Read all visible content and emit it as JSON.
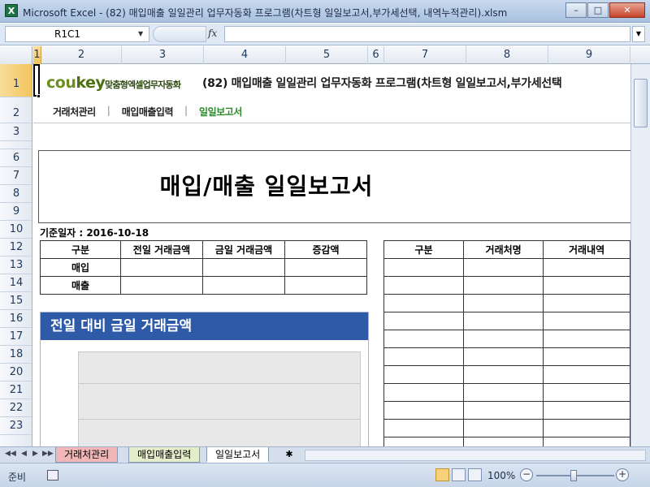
{
  "window": {
    "title": "Microsoft Excel - (82) 매입매출 일일관리 업무자동화 프로그램(차트형 일일보고서,부가세선택, 내역누적관리).xlsm",
    "app_icon": "X",
    "minimize": "–",
    "restore": "□",
    "close": "✕"
  },
  "formula_bar": {
    "name_box": "R1C1",
    "fx": "fx",
    "formula": ""
  },
  "columns": [
    "1",
    "2",
    "3",
    "4",
    "5",
    "6",
    "7",
    "8",
    "9"
  ],
  "rows": [
    "1",
    "2",
    "3",
    "6",
    "7",
    "8",
    "9",
    "10",
    "12",
    "13",
    "14",
    "15",
    "16",
    "17",
    "18",
    "20",
    "21",
    "22",
    "23"
  ],
  "header": {
    "logo_main": "cou",
    "logo_k": "key",
    "logo_tag": "맞춤형엑셀업무자동화",
    "doc_title": "(82) 매입매출 일일관리 업무자동화 프로그램(차트형 일일보고서,부가세선택"
  },
  "menu": {
    "item1": "거래처관리",
    "item2": "매입매출입력",
    "item3": "일일보고서",
    "sep": "|"
  },
  "report": {
    "title": "매입/매출 일일보고서",
    "base_date": "기준일자 : 2016-10-18"
  },
  "summary_table": {
    "headers": [
      "구분",
      "전일 거래금액",
      "금일 거래금액",
      "증감액"
    ],
    "rows": [
      [
        "매입",
        "",
        "",
        ""
      ],
      [
        "매출",
        "",
        "",
        ""
      ]
    ]
  },
  "detail_table": {
    "headers": [
      "구분",
      "거래처명",
      "거래내역"
    ]
  },
  "chart_panel": {
    "title": "전일 대비 금일 거래금액"
  },
  "sheet_tabs": {
    "tab1": "거래처관리",
    "tab2": "매입매출입력",
    "tab3": "일일보고서"
  },
  "status": {
    "ready": "준비",
    "zoom": "100%",
    "minus": "−",
    "plus": "+"
  }
}
